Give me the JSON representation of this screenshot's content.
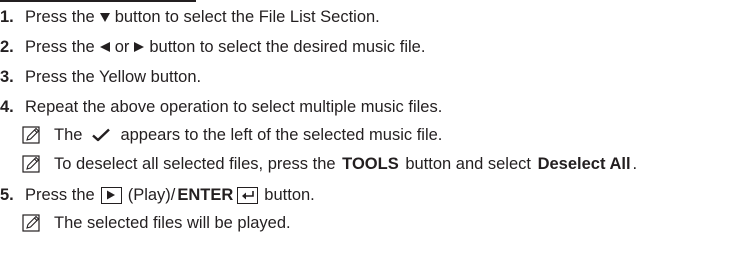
{
  "steps": [
    {
      "num": "1.",
      "pre": "Press the",
      "post": "button to select the File List Section."
    },
    {
      "num": "2.",
      "pre": "Press the",
      "mid": "or",
      "post": "button to select the desired music file."
    },
    {
      "num": "3.",
      "text": "Press the Yellow button."
    },
    {
      "num": "4.",
      "text": "Repeat the above operation to select multiple music files."
    },
    {
      "num": "5.",
      "pre": "Press the",
      "play": "(Play)/",
      "enter": "ENTER",
      "post": "button."
    }
  ],
  "notes": [
    {
      "pre": "The",
      "post": "appears to the left of the selected music file."
    },
    {
      "pre": "To deselect all selected files, press the",
      "tools": "TOOLS",
      "mid": "button and select",
      "deselect": "Deselect All",
      "end": "."
    },
    {
      "text": "The selected files will be played."
    }
  ],
  "icons": {
    "down": "down-triangle-icon",
    "left": "left-triangle-icon",
    "right": "right-triangle-icon",
    "note": "note-pencil-icon",
    "check": "checkmark-icon",
    "play": "play-button-icon",
    "enter": "enter-button-icon"
  }
}
